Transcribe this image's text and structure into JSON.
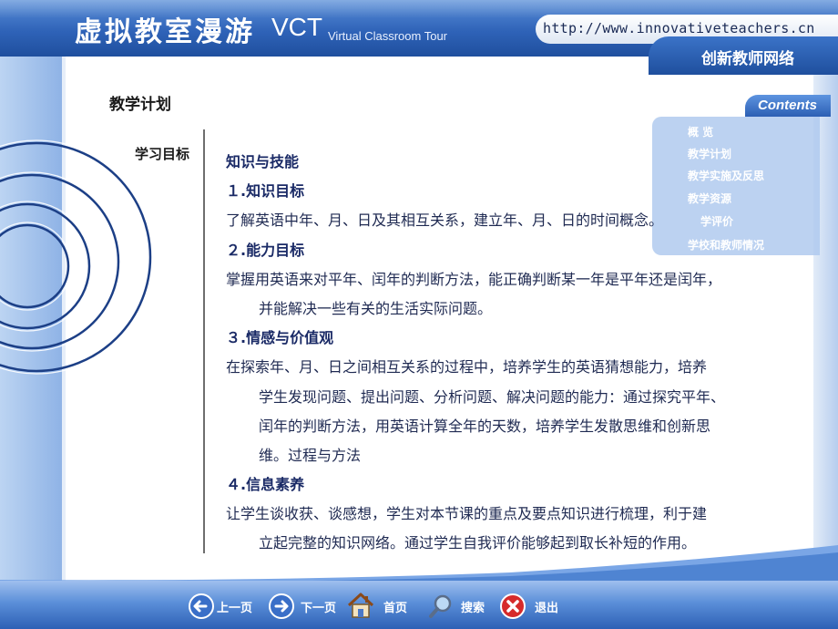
{
  "header": {
    "logo_cn": "虚拟教室漫游",
    "logo_vct": "VCT",
    "logo_sub": "Virtual Classroom Tour",
    "url": "http://www.innovativeteachers.cn",
    "brand": "创新教师网络"
  },
  "contents": {
    "label": "Contents",
    "items": [
      "概 览",
      "教学计划",
      "教学实施及反思",
      "教学资源",
      "学评价",
      "学校和教师情况"
    ]
  },
  "main": {
    "page_title": "教学计划",
    "section_label": "学习目标",
    "lines": [
      "知识与技能",
      "１.知识目标",
      "了解英语中年、月、日及其相互关系，建立年、月、日的时间概念。",
      "２.能力目标",
      "掌握用英语来对平年、闰年的判断方法，能正确判断某一年是平年还是闰年，",
      "并能解决一些有关的生活实际问题。",
      "３.情感与价值观",
      "在探索年、月、日之间相互关系的过程中，培养学生的英语猜想能力，培养",
      "学生发现问题、提出问题、分析问题、解决问题的能力：通过探究平年、",
      "闰年的判断方法，用英语计算全年的天数，培养学生发散思维和创新思",
      "维。过程与方法",
      "４.信息素养",
      "让学生谈收获、谈感想，学生对本节课的重点及要点知识进行梳理，利于建",
      "立起完整的知识网络。通过学生自我评价能够起到取长补短的作用。"
    ]
  },
  "nav": {
    "prev": "上一页",
    "next": "下一页",
    "home": "首页",
    "search": "搜索",
    "exit": "退出"
  },
  "colors": {
    "header_blue": "#2f63b8",
    "text_navy": "#1f2a52",
    "panel_blue": "#adc8ee"
  }
}
